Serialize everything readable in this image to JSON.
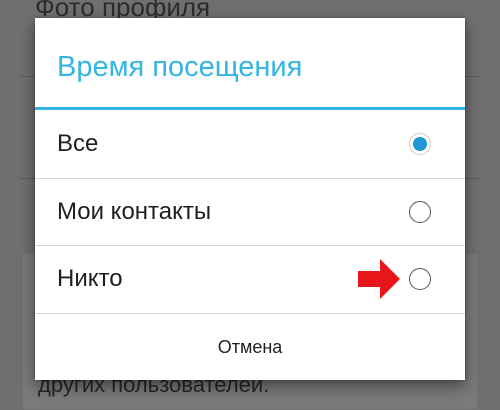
{
  "background": {
    "top_text": "Фото профиля",
    "bottom_text": "других пользователей."
  },
  "dialog": {
    "title": "Время посещения",
    "options": [
      {
        "label": "Все",
        "selected": true
      },
      {
        "label": "Мои контакты",
        "selected": false
      },
      {
        "label": "Никто",
        "selected": false
      }
    ],
    "cancel_label": "Отмена"
  },
  "colors": {
    "accent": "#33b5e5",
    "radio_selected": "#1f98d6",
    "arrow": "#e8151b"
  },
  "icons": {
    "pointer": "red-arrow-icon"
  }
}
